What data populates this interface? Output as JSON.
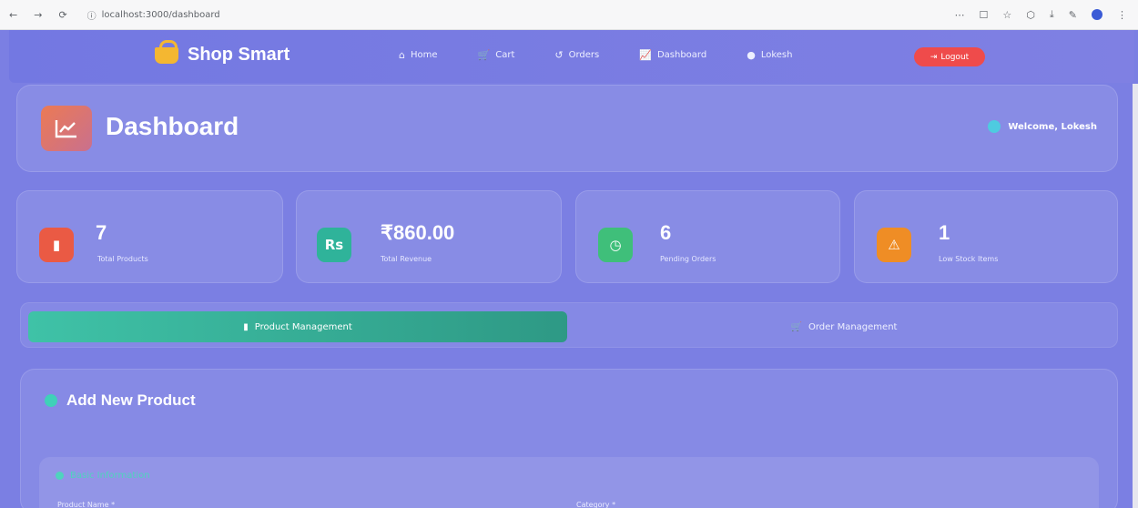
{
  "browser": {
    "nav": [
      "←",
      "→",
      "⟳"
    ],
    "url": "localhost:3000/dashboard",
    "right_icons": [
      "⋯",
      "☐",
      "☆",
      "⬡",
      "⤓",
      "✎",
      "⋮"
    ]
  },
  "nav": {
    "brand": "Shop Smart",
    "links": [
      {
        "icon": "⌂",
        "label": "Home"
      },
      {
        "icon": "🛒",
        "label": "Cart"
      },
      {
        "icon": "↺",
        "label": "Orders"
      },
      {
        "icon": "📈",
        "label": "Dashboard"
      },
      {
        "icon": "●",
        "label": "Lokesh"
      }
    ],
    "logout": "Logout"
  },
  "header": {
    "title": "Dashboard",
    "welcome": "Welcome, Lokesh"
  },
  "stats": [
    {
      "value": "7",
      "label": "Total Products",
      "icon": "▮",
      "color": "#ea5a44"
    },
    {
      "value": "₹860.00",
      "label": "Total Revenue",
      "icon": "Rs",
      "color": "#2fb39a"
    },
    {
      "value": "6",
      "label": "Pending Orders",
      "icon": "◷",
      "color": "#3fbf7a"
    },
    {
      "value": "1",
      "label": "Low Stock Items",
      "icon": "⚠",
      "color": "#ef8d25"
    }
  ],
  "tabs": {
    "product": "Product Management",
    "order": "Order Management"
  },
  "panel": {
    "title": "Add New Product",
    "section_title": "Basic Information",
    "field1": "Product Name *",
    "field2": "Category *"
  },
  "colors": {
    "background": "#7b7fe3",
    "active_tab": "#3fc2a7",
    "logout": "#ef4b4b"
  }
}
